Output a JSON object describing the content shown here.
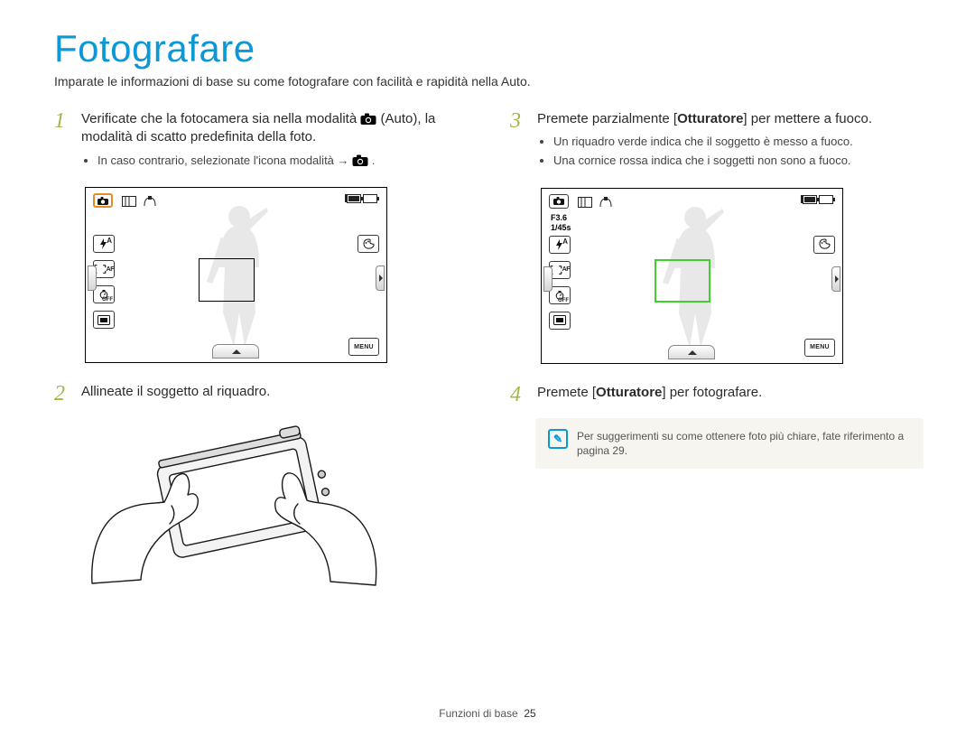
{
  "title": "Fotografare",
  "subtitle": "Imparate le informazioni di base su come fotografare con facilità e rapidità nella Auto.",
  "steps": {
    "s1": {
      "num": "1",
      "text_a": "Verificate che la fotocamera sia nella modalità ",
      "text_b": " (Auto), la modalità di scatto predefinita della foto.",
      "bullet_a": "In caso contrario, selezionate l'icona modalità ",
      "bullet_arrow": "→",
      "bullet_b": "."
    },
    "s2": {
      "num": "2",
      "text": "Allineate il soggetto al riquadro."
    },
    "s3": {
      "num": "3",
      "text_a": "Premete parzialmente [",
      "text_bold": "Otturatore",
      "text_b": "] per mettere a fuoco.",
      "bullets": [
        "Un riquadro verde indica che il soggetto è messo a fuoco.",
        "Una cornice rossa indica che i soggetti non sono a fuoco."
      ]
    },
    "s4": {
      "num": "4",
      "text_a": "Premete [",
      "text_bold": "Otturatore",
      "text_b": "] per fotografare."
    }
  },
  "screen1": {
    "exposure_label_top": "",
    "exposure_label_bottom": "",
    "menu_label": "MENU",
    "flash_label": "A",
    "af_label": "AF",
    "off_label": "OFF"
  },
  "screen2": {
    "f_number": "F3.6",
    "shutter": "1/45s",
    "menu_label": "MENU",
    "flash_label": "A",
    "af_label": "AF",
    "off_label": "OFF"
  },
  "note": {
    "icon": "✎",
    "text": "Per suggerimenti su come ottenere foto più chiare, fate riferimento a pagina 29."
  },
  "footer": {
    "section": "Funzioni di base",
    "page": "25"
  },
  "icons": {
    "camera": "camera-icon"
  }
}
